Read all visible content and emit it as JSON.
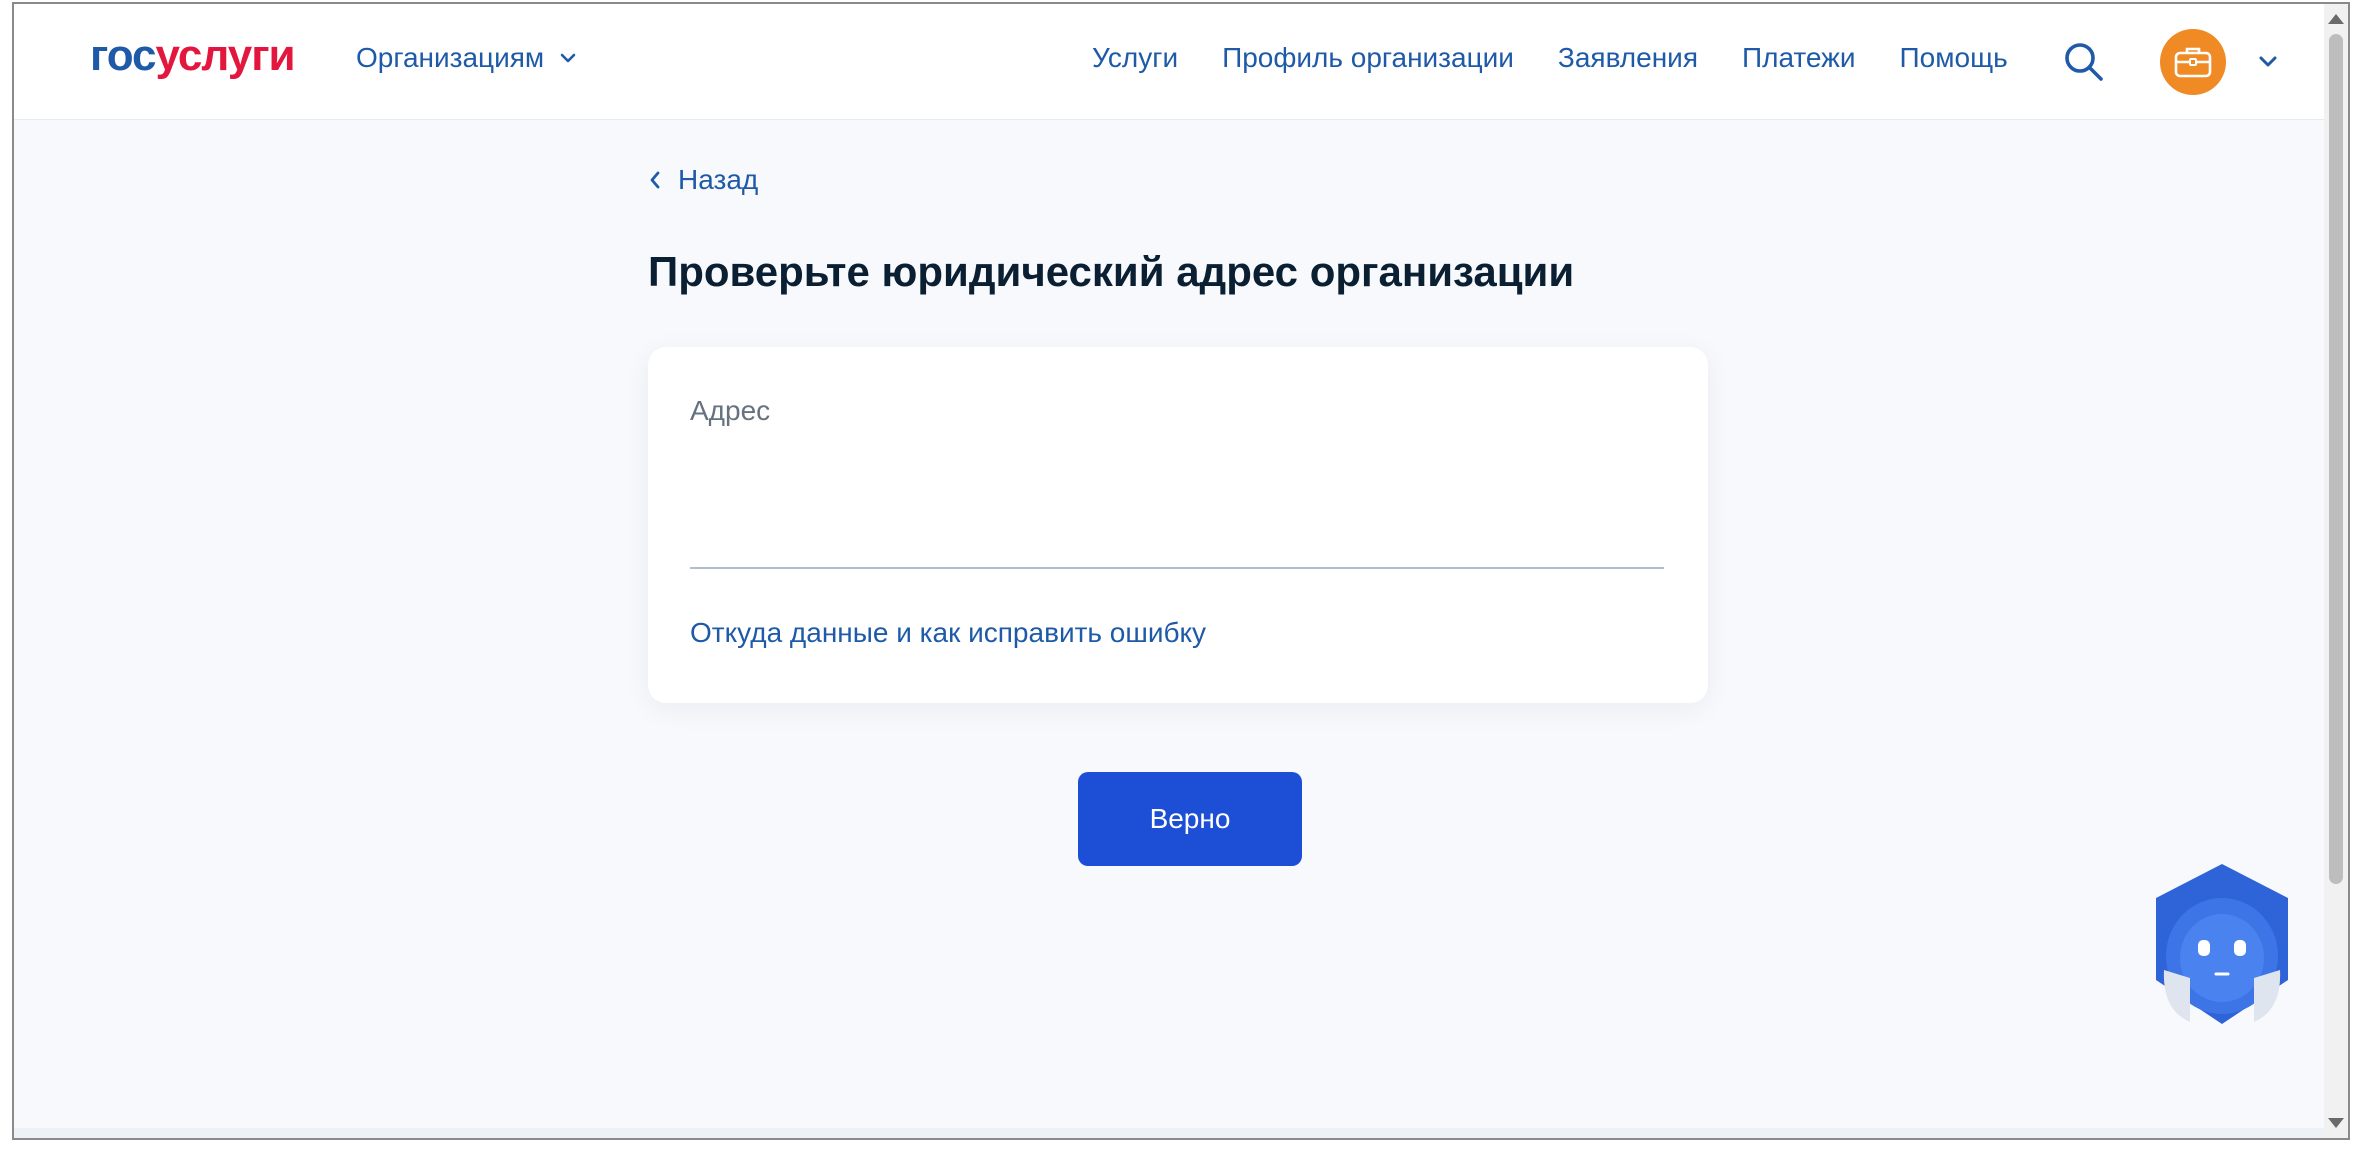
{
  "header": {
    "logo_part1": "гос",
    "logo_part2": "услуги",
    "org_menu_label": "Организациям",
    "nav": [
      {
        "label": "Услуги"
      },
      {
        "label": "Профиль организации"
      },
      {
        "label": "Заявления"
      },
      {
        "label": "Платежи"
      },
      {
        "label": "Помощь"
      }
    ],
    "icons": {
      "search": "search-icon",
      "avatar": "briefcase-icon",
      "chevron": "chevron-down-icon"
    }
  },
  "main": {
    "back_label": "Назад",
    "title": "Проверьте юридический адрес организации",
    "card": {
      "field_label": "Адрес",
      "field_value": "",
      "help_link": "Откуда данные и как исправить ошибку"
    },
    "confirm_button": "Верно"
  },
  "colors": {
    "brand_blue": "#1e5aa8",
    "brand_red": "#e3163e",
    "button_blue": "#1c4fd6",
    "avatar_orange": "#f08a24",
    "page_background": "#f7f9fc"
  }
}
